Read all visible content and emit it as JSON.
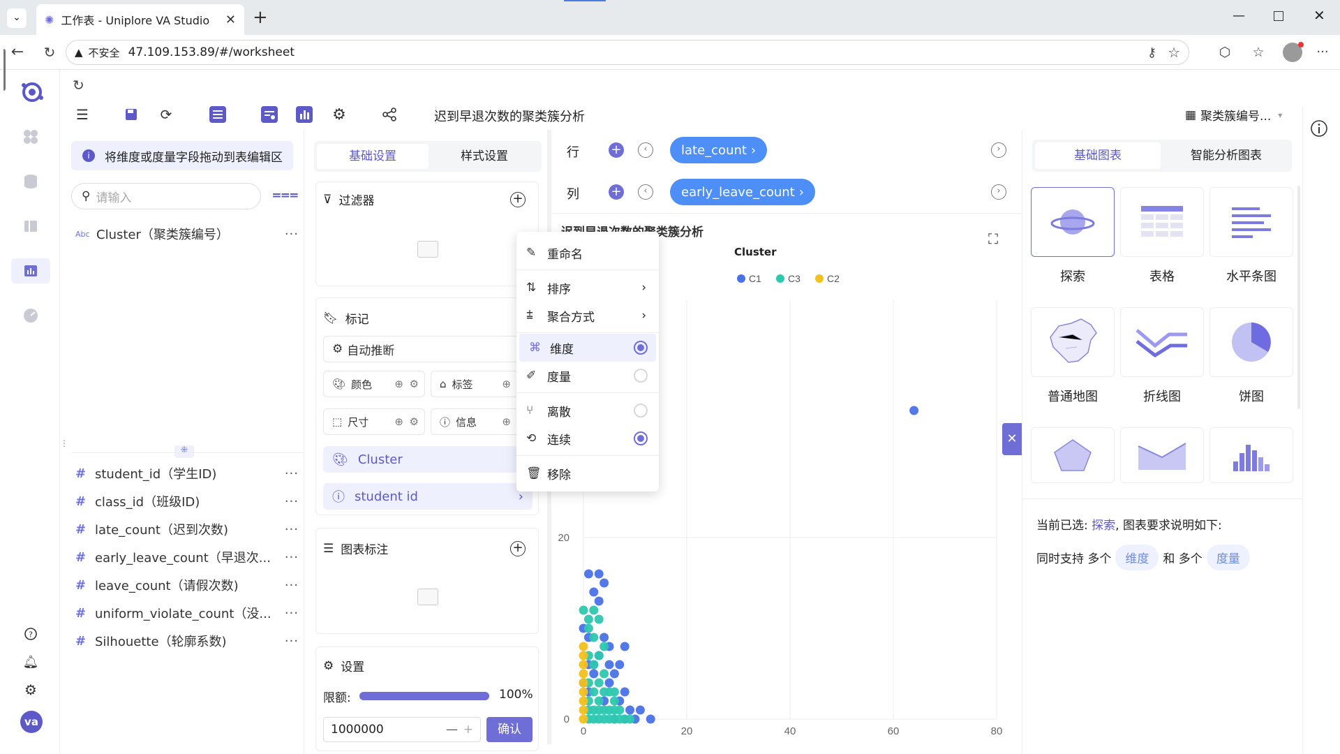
{
  "browser": {
    "tab_title": "工作表 - Uniplore VA Studio",
    "not_secure": "不安全",
    "url": "47.109.153.89/#/worksheet"
  },
  "toolbar": {
    "worksheet_title": "迟到早退次数的聚类簇分析",
    "right_selector": "聚类簇编号..."
  },
  "fields_panel": {
    "hint": "将维度或度量字段拖动到表编辑区",
    "search_placeholder": "请输入",
    "dimensions": [
      {
        "type": "Abc",
        "label": "Cluster（聚类簇编号）"
      }
    ],
    "measures": [
      {
        "label": "student_id（学生ID)"
      },
      {
        "label": "class_id（班级ID)"
      },
      {
        "label": "late_count（迟到次数)"
      },
      {
        "label": "early_leave_count（早退次..."
      },
      {
        "label": "leave_count（请假次数)"
      },
      {
        "label": "uniform_violate_count（没..."
      },
      {
        "label": "Silhouette（轮廓系数)"
      }
    ],
    "more": "···"
  },
  "settings_panel": {
    "tab_basic": "基础设置",
    "tab_style": "样式设置",
    "filter_title": "过滤器",
    "marks_title": "标记",
    "auto_infer": "自动推断",
    "color": "颜色",
    "label": "标签",
    "size": "尺寸",
    "info": "信息",
    "mark_fields": [
      "Cluster",
      "student id"
    ],
    "annotation_title": "图表标注",
    "settings_title": "设置",
    "limit_label": "限额:",
    "limit_percent": "100%",
    "limit_fill": 1.0,
    "limit_value": "1000000",
    "confirm": "确认"
  },
  "shelves": {
    "row_label": "行",
    "col_label": "列",
    "row_pill": "late_count",
    "col_pill": "early_leave_count"
  },
  "context_menu": {
    "items": [
      {
        "label": "重命名",
        "icon": "edit-icon"
      },
      {
        "label": "排序",
        "icon": "sort-icon",
        "submenu": true
      },
      {
        "label": "聚合方式",
        "icon": "aggregate-icon",
        "submenu": true
      },
      {
        "label": "维度",
        "icon": "dimension-icon",
        "radio": true,
        "checked": true
      },
      {
        "label": "度量",
        "icon": "measure-icon",
        "radio": true,
        "checked": false
      },
      {
        "label": "离散",
        "icon": "discrete-icon",
        "radio": true,
        "checked": false
      },
      {
        "label": "连续",
        "icon": "continuous-icon",
        "radio": true,
        "checked": true
      },
      {
        "label": "移除",
        "icon": "trash-icon"
      }
    ]
  },
  "chart_panel": {
    "title": "迟到早退次数的聚类簇分析",
    "legend_title": "Cluster"
  },
  "chart_data": {
    "type": "scatter",
    "title": "迟到早退次数的聚类簇分析",
    "legend_title": "Cluster",
    "legend": [
      "C1",
      "C3",
      "C2"
    ],
    "colors": {
      "C1": "#4a72e8",
      "C3": "#2ec7b0",
      "C2": "#f2c01f"
    },
    "xlim": [
      0,
      80
    ],
    "x_ticks": [
      "0",
      "20",
      "40",
      "60",
      "80"
    ],
    "y_ticks": [
      "0",
      "20"
    ],
    "series": [
      {
        "name": "C1",
        "points": [
          [
            64,
            34
          ],
          [
            1,
            16
          ],
          [
            3,
            16
          ],
          [
            4,
            15
          ],
          [
            2,
            14
          ],
          [
            3,
            13
          ],
          [
            0,
            10
          ],
          [
            1,
            9
          ],
          [
            4,
            9
          ],
          [
            5,
            8
          ],
          [
            8,
            8
          ],
          [
            3,
            7
          ],
          [
            1,
            6
          ],
          [
            2,
            6
          ],
          [
            5,
            6
          ],
          [
            7,
            6
          ],
          [
            2,
            5
          ],
          [
            6,
            5
          ],
          [
            0,
            4
          ],
          [
            5,
            4
          ],
          [
            8,
            3
          ],
          [
            1,
            3
          ],
          [
            4,
            2
          ],
          [
            7,
            2
          ],
          [
            9,
            1
          ],
          [
            11,
            1
          ],
          [
            13,
            0
          ],
          [
            10,
            0
          ],
          [
            6,
            0
          ],
          [
            8,
            0
          ]
        ]
      },
      {
        "name": "C3",
        "points": [
          [
            0,
            12
          ],
          [
            2,
            12
          ],
          [
            1,
            11
          ],
          [
            3,
            11
          ],
          [
            1,
            10
          ],
          [
            2,
            9
          ],
          [
            4,
            8
          ],
          [
            3,
            7
          ],
          [
            1,
            7
          ],
          [
            2,
            6
          ],
          [
            4,
            5
          ],
          [
            3,
            4
          ],
          [
            1,
            4
          ],
          [
            5,
            3
          ],
          [
            2,
            3
          ],
          [
            6,
            2
          ],
          [
            3,
            2
          ],
          [
            1,
            2
          ],
          [
            7,
            1
          ],
          [
            4,
            1
          ],
          [
            2,
            1
          ],
          [
            8,
            0
          ],
          [
            6,
            0
          ],
          [
            4,
            0
          ],
          [
            2,
            0
          ],
          [
            1,
            0
          ],
          [
            3,
            0
          ],
          [
            5,
            0
          ],
          [
            7,
            0
          ],
          [
            9,
            0
          ],
          [
            3,
            1
          ],
          [
            5,
            1
          ],
          [
            6,
            1
          ],
          [
            1,
            1
          ],
          [
            4,
            3
          ],
          [
            6,
            3
          ]
        ]
      },
      {
        "name": "C2",
        "points": [
          [
            0,
            7
          ],
          [
            0,
            6
          ],
          [
            0,
            5
          ],
          [
            0,
            4
          ],
          [
            0,
            3
          ],
          [
            0,
            2
          ],
          [
            0,
            1
          ],
          [
            0,
            0
          ],
          [
            0,
            8
          ]
        ]
      }
    ]
  },
  "gallery": {
    "tab_basic": "基础图表",
    "tab_smart": "智能分析图表",
    "items": [
      {
        "label": "探索",
        "icon": "planet-icon"
      },
      {
        "label": "表格",
        "icon": "table-icon"
      },
      {
        "label": "水平条图",
        "icon": "hbar-icon"
      },
      {
        "label": "普通地图",
        "icon": "map-icon"
      },
      {
        "label": "折线图",
        "icon": "line-icon"
      },
      {
        "label": "饼图",
        "icon": "pie-icon"
      },
      {
        "label": "",
        "icon": "radar-icon"
      },
      {
        "label": "",
        "icon": "area-icon"
      },
      {
        "label": "",
        "icon": "bar-icon"
      }
    ],
    "selected_prefix": "当前已选:",
    "selected_name": "探索",
    "selected_suffix": ", 图表要求说明如下:",
    "support_text_1": "同时支持 多个",
    "support_tag_1": "维度",
    "support_text_2": "和 多个",
    "support_tag_2": "度量"
  },
  "left_nav": {
    "avatar": "va"
  }
}
